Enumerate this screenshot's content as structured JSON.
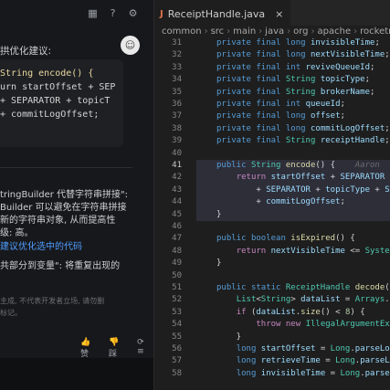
{
  "left_panel": {
    "toolbar_icons": [
      "grid-icon",
      "help-icon",
      "settings-icon"
    ],
    "toolbar_glyphs": [
      "▦",
      "?",
      "⚙"
    ],
    "avatar_text": "☺",
    "suggest_title": "拱优化建议:",
    "code_lines": [
      "String encode() {",
      "urn startOffset + SEP",
      "+ SEPARATOR + topicT",
      "+ commitLogOffset;"
    ],
    "explain_lines": [
      "tringBuilder 代替字符串拼接\":",
      "Builder 可以避免在字符串拼接",
      "新的字符串对象, 从而提高性",
      "级: 高。"
    ],
    "link_text": "建议优化选中的代码",
    "extract_text": "共部分到变量\": 将重复出现的",
    "footer_lines": [
      "主成, 不代表开发者立场, 请勿删",
      "标记。"
    ],
    "actions": [
      "👍 赞",
      "👎 踩",
      "⟳ ≡"
    ]
  },
  "editor": {
    "tab": {
      "icon_text": "J",
      "label": "ReceiptHandle.java",
      "close": "×"
    },
    "breadcrumb": [
      "common",
      "src",
      "main",
      "java",
      "org",
      "apache",
      "rocketmq"
    ],
    "lines": [
      {
        "no": "31",
        "code": "private final long invisibleTime;"
      },
      {
        "no": "32",
        "code": "private final long nextVisibleTime;"
      },
      {
        "no": "33",
        "code": "private final int reviveQueueId;"
      },
      {
        "no": "34",
        "code": "private final String topicType;"
      },
      {
        "no": "35",
        "code": "private final String brokerName;"
      },
      {
        "no": "36",
        "code": "private final int queueId;"
      },
      {
        "no": "37",
        "code": "private final long offset;"
      },
      {
        "no": "38",
        "code": "private final long commitLogOffset;"
      },
      {
        "no": "39",
        "code": "private final String receiptHandle;"
      },
      {
        "no": "40",
        "code": ""
      },
      {
        "no": "41",
        "code": "public String encode() {"
      },
      {
        "no": "42",
        "code": "    return startOffset + SEPARATOR + "
      },
      {
        "no": "43",
        "code": "        + SEPARATOR + topicType + SE"
      },
      {
        "no": "44",
        "code": "        + commitLogOffset;"
      },
      {
        "no": "45",
        "code": "}"
      },
      {
        "no": "46",
        "code": ""
      },
      {
        "no": "47",
        "code": "public boolean isExpired() {"
      },
      {
        "no": "48",
        "code": "    return nextVisibleTime <= System"
      },
      {
        "no": "49",
        "code": "}"
      },
      {
        "no": "50",
        "code": ""
      },
      {
        "no": "51",
        "code": "public static ReceiptHandle decode(S"
      },
      {
        "no": "52",
        "code": "    List<String> dataList = Arrays.a"
      },
      {
        "no": "53",
        "code": "    if (dataList.size() < 8) {"
      },
      {
        "no": "54",
        "code": "        throw new IllegalArgumentExce"
      },
      {
        "no": "55",
        "code": "    }"
      },
      {
        "no": "56",
        "code": "    long startOffset = Long.parseLo"
      },
      {
        "no": "57",
        "code": "    long retrieveTime = Long.parseLo"
      },
      {
        "no": "58",
        "code": "    long invisibleTime = Long.parseL"
      }
    ],
    "author_hint": "Aaron",
    "current_line": "41"
  }
}
